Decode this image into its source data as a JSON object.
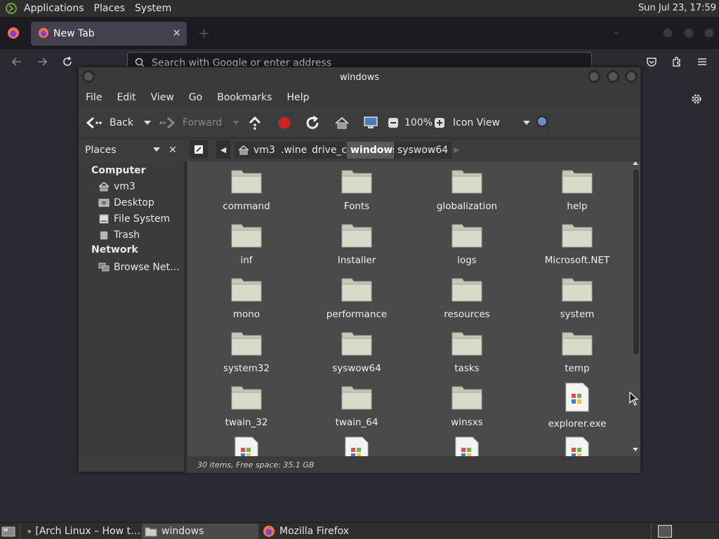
{
  "top_panel": {
    "menus": [
      "Applications",
      "Places",
      "System"
    ],
    "clock": "Sun Jul 23, 17:59"
  },
  "firefox": {
    "tab_title": "New Tab",
    "tab_close": "✕",
    "new_tab": "+",
    "dropdown": "⌄",
    "url_placeholder": "Search with Google or enter address"
  },
  "fm": {
    "window_title": "windows",
    "menu": [
      "File",
      "Edit",
      "View",
      "Go",
      "Bookmarks",
      "Help"
    ],
    "toolbar": {
      "back": "Back",
      "forward": "Forward",
      "zoom": "100%",
      "view_mode": "Icon View"
    },
    "sidebar_combo": "Places",
    "sidebar_close": "✕",
    "breadcrumbs": [
      "vm3",
      ".wine",
      "drive_c",
      "windows",
      "syswow64"
    ],
    "active_crumb_index": 3,
    "sidebar": {
      "computer_header": "Computer",
      "computer_items": [
        {
          "label": "vm3",
          "icon": "home-icon"
        },
        {
          "label": "Desktop",
          "icon": "desktop-icon"
        },
        {
          "label": "File System",
          "icon": "drive-icon"
        },
        {
          "label": "Trash",
          "icon": "trash-icon"
        }
      ],
      "network_header": "Network",
      "network_items": [
        {
          "label": "Browse Net…",
          "icon": "network-icon"
        }
      ]
    },
    "items": [
      {
        "name": "command",
        "type": "folder"
      },
      {
        "name": "Fonts",
        "type": "folder"
      },
      {
        "name": "globalization",
        "type": "folder"
      },
      {
        "name": "help",
        "type": "folder"
      },
      {
        "name": "inf",
        "type": "folder"
      },
      {
        "name": "Installer",
        "type": "folder"
      },
      {
        "name": "logs",
        "type": "folder"
      },
      {
        "name": "Microsoft.NET",
        "type": "folder"
      },
      {
        "name": "mono",
        "type": "folder"
      },
      {
        "name": "performance",
        "type": "folder"
      },
      {
        "name": "resources",
        "type": "folder"
      },
      {
        "name": "system",
        "type": "folder"
      },
      {
        "name": "system32",
        "type": "folder"
      },
      {
        "name": "syswow64",
        "type": "folder"
      },
      {
        "name": "tasks",
        "type": "folder"
      },
      {
        "name": "temp",
        "type": "folder"
      },
      {
        "name": "twain_32",
        "type": "folder"
      },
      {
        "name": "twain_64",
        "type": "folder"
      },
      {
        "name": "winsxs",
        "type": "folder"
      },
      {
        "name": "explorer.exe",
        "type": "exe"
      },
      {
        "name": "",
        "type": "exe"
      },
      {
        "name": "",
        "type": "exe"
      },
      {
        "name": "",
        "type": "exe"
      },
      {
        "name": "",
        "type": "exe"
      }
    ],
    "status": "30 items, Free space: 35.1 GB"
  },
  "taskbar": {
    "tasks": [
      {
        "label": "[Arch Linux – How t…",
        "icon": "chrome-icon",
        "active": false
      },
      {
        "label": "windows",
        "icon": "folder-icon",
        "active": true
      },
      {
        "label": "Mozilla Firefox",
        "icon": "firefox-icon",
        "active": false
      }
    ]
  },
  "colors": {
    "folder": "#d8d8c8",
    "accent_red": "#cc2222",
    "active_crumb": "#5a5a5a"
  }
}
